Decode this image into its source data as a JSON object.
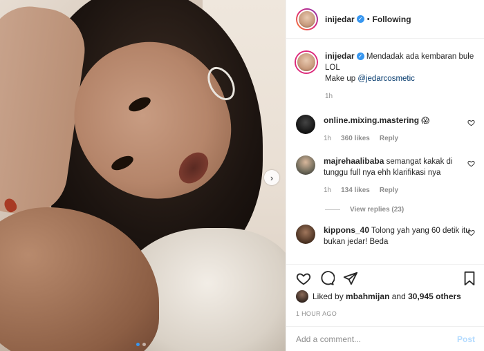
{
  "header": {
    "username": "inijedar",
    "separator": "•",
    "follow_status": "Following"
  },
  "caption": {
    "username": "inijedar",
    "text": "Mendadak ada kembaran bule LOL",
    "line2_prefix": "Make up ",
    "mention": "@jedarcosmetic",
    "time": "1h"
  },
  "comments": [
    {
      "username": "online.mixing.mastering",
      "text": "😱",
      "time": "1h",
      "likes": "360 likes",
      "reply": "Reply"
    },
    {
      "username": "majrehaalibaba",
      "text": "semangat kakak di tunggu full nya ehh klarifikasi nya",
      "time": "1h",
      "likes": "134 likes",
      "reply": "Reply"
    },
    {
      "username": "kippons_40",
      "text": "Tolong yah yang 60 detik itu bukan jedar! Beda"
    }
  ],
  "view_replies": "View replies (23)",
  "likes": {
    "prefix": "Liked by ",
    "liker": "mbahmijan",
    "middle": " and ",
    "others": "30,945 others"
  },
  "timestamp": "1 HOUR AGO",
  "add_comment": {
    "placeholder": "Add a comment...",
    "post_label": "Post"
  },
  "carousel": {
    "current": 1,
    "total": 2
  },
  "colors": {
    "verified": "#3897f0",
    "post_disabled": "#b3dbff",
    "active_dot": "#3897f0"
  }
}
